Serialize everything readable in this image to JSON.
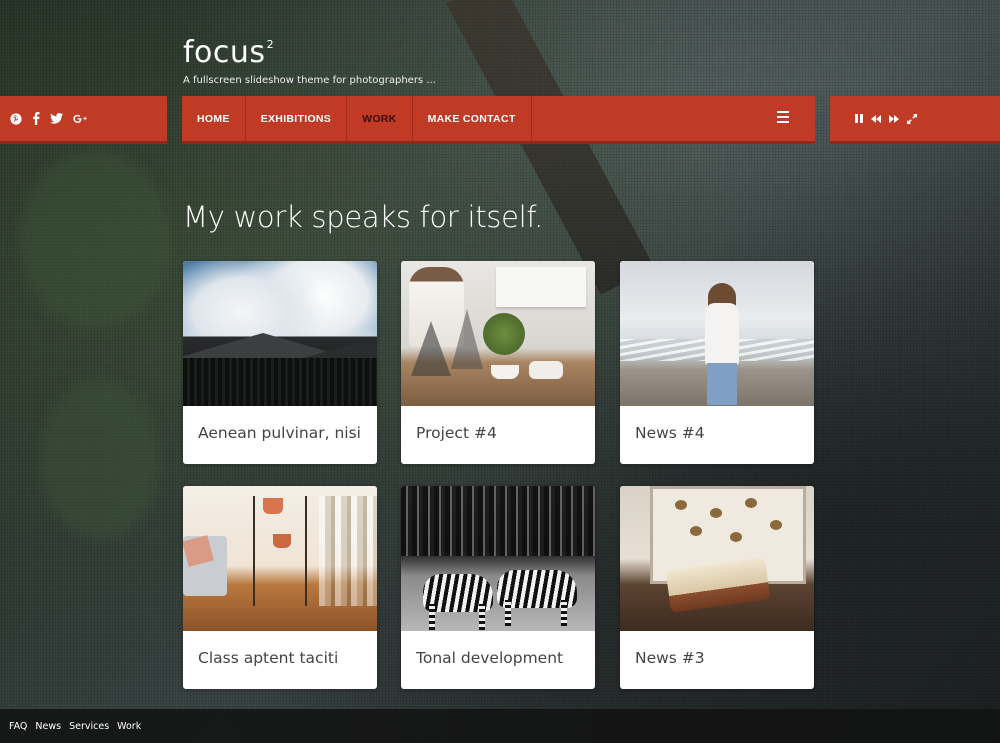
{
  "site": {
    "title": "focus",
    "title_sup": "2",
    "tagline": "A fullscreen slideshow theme for photographers  ..."
  },
  "social": [
    {
      "name": "pinterest-icon",
      "glyph": "P"
    },
    {
      "name": "facebook-icon",
      "glyph": "f"
    },
    {
      "name": "twitter-icon",
      "glyph": "t"
    },
    {
      "name": "google-plus-icon",
      "glyph": "g+"
    }
  ],
  "nav": {
    "items": [
      {
        "label": "HOME",
        "active": false
      },
      {
        "label": "EXHIBITIONS",
        "active": false
      },
      {
        "label": "WORK",
        "active": true
      },
      {
        "label": "MAKE CONTACT",
        "active": false
      }
    ]
  },
  "player": {
    "controls": [
      "pause-icon",
      "previous-icon",
      "next-icon",
      "fullscreen-icon"
    ]
  },
  "main": {
    "heading": "My work speaks for itself."
  },
  "cards": [
    {
      "title": "Aenean pulvinar, nisi"
    },
    {
      "title": "Project #4"
    },
    {
      "title": "News #4"
    },
    {
      "title": "Class aptent taciti"
    },
    {
      "title": "Tonal development"
    },
    {
      "title": "News #3"
    }
  ],
  "footer": {
    "links": [
      "FAQ",
      "News",
      "Services",
      "Work"
    ]
  },
  "colors": {
    "accent": "#c13a25",
    "accent_dark": "#8f2a1a",
    "active_nav": "#3a0d06"
  }
}
